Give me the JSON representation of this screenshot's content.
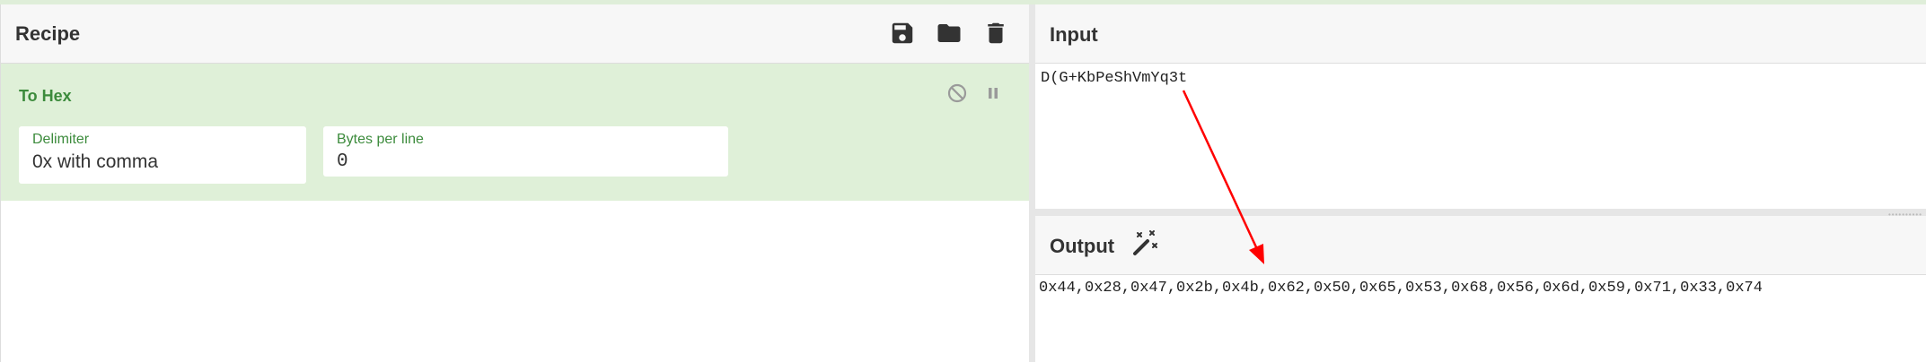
{
  "recipe": {
    "title": "Recipe",
    "icons": [
      "save-icon",
      "folder-icon",
      "trash-icon"
    ],
    "operation": {
      "title": "To Hex",
      "controls": [
        "disable-icon",
        "pause-icon"
      ],
      "args": [
        {
          "label": "Delimiter",
          "value": "0x with comma"
        },
        {
          "label": "Bytes per line",
          "value": "0"
        }
      ]
    }
  },
  "input": {
    "title": "Input",
    "text": "D(G+KbPeShVmYq3t"
  },
  "output": {
    "title": "Output",
    "magic_icon": "magic-wand-icon",
    "text": "0x44,0x28,0x47,0x2b,0x4b,0x62,0x50,0x65,0x53,0x68,0x56,0x6d,0x59,0x71,0x33,0x74"
  },
  "colors": {
    "accent_green": "#3c8b3c",
    "card_background": "#dff0d8",
    "annotation_arrow": "#ff0000"
  }
}
